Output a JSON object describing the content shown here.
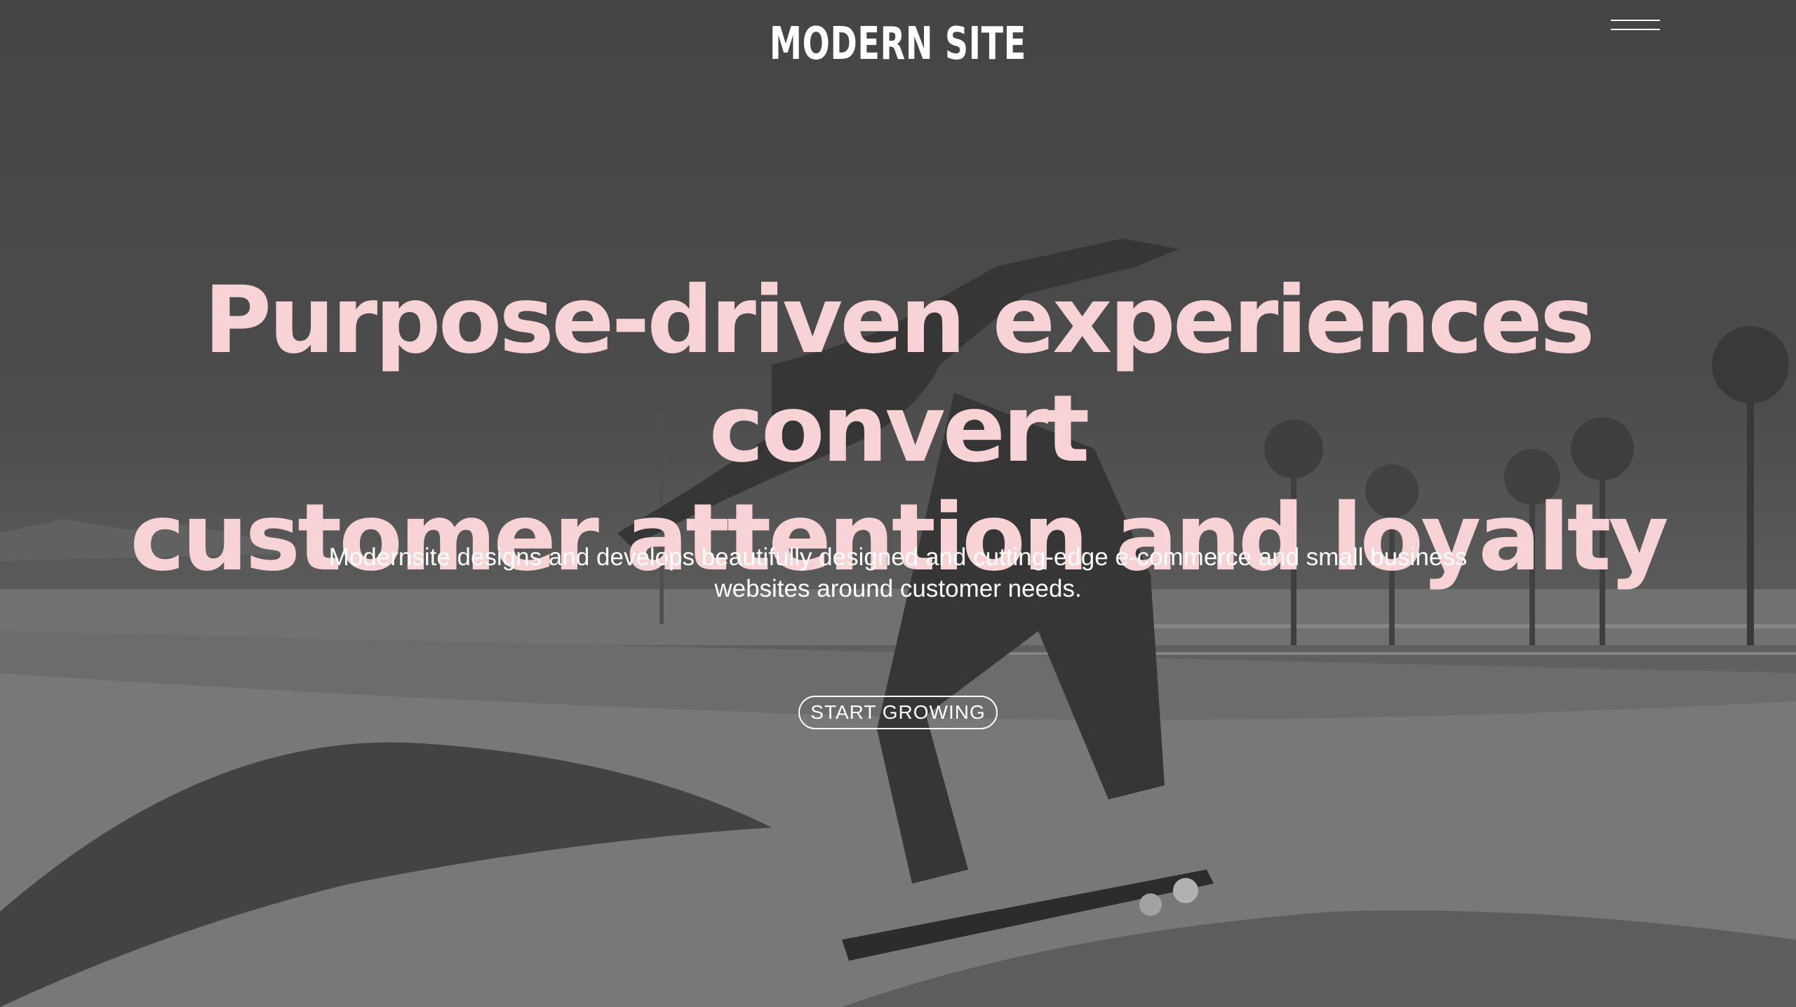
{
  "site": {
    "logo_text": "MODERN SITE"
  },
  "header": {
    "menu_icon": "hamburger-menu-icon"
  },
  "hero": {
    "headline_line1": "Purpose-driven experiences convert",
    "headline_line2": "customer attention and loyalty",
    "subtext_line1": "Modernsite designs and develops beautifully designed and cutting-edge e-commerce and small business",
    "subtext_line2": "websites around customer needs.",
    "cta_label": "START GROWING",
    "background_image": "skateboarder-skatepark-photo"
  },
  "colors": {
    "headline": "#f7d3d6",
    "text": "#ffffff",
    "background": "#4f4f4f"
  }
}
